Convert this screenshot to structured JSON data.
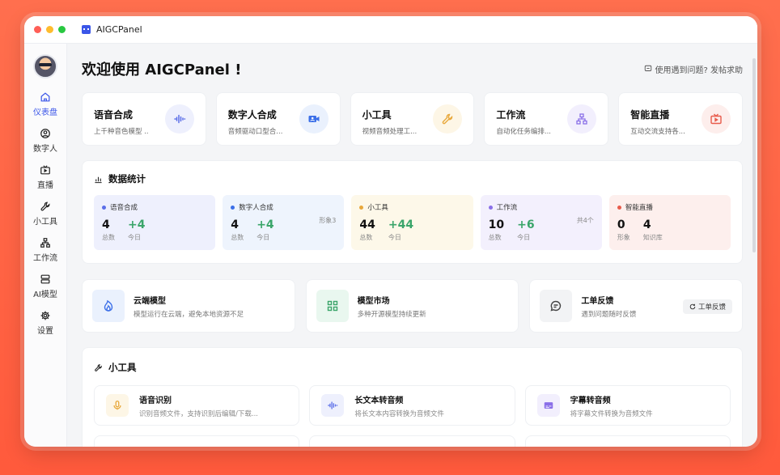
{
  "window": {
    "app_title": "AIGCPanel",
    "traffic_lights": [
      "#ff5f57",
      "#febc2e",
      "#28c840"
    ]
  },
  "sidebar": {
    "items": [
      {
        "label": "仪表盘",
        "icon": "home-icon",
        "active": true
      },
      {
        "label": "数字人",
        "icon": "user-circle-icon",
        "active": false
      },
      {
        "label": "直播",
        "icon": "tv-icon",
        "active": false
      },
      {
        "label": "小工具",
        "icon": "wrench-icon",
        "active": false
      },
      {
        "label": "工作流",
        "icon": "workflow-icon",
        "active": false
      },
      {
        "label": "AI模型",
        "icon": "server-icon",
        "active": false
      },
      {
        "label": "设置",
        "icon": "gear-icon",
        "active": false
      }
    ]
  },
  "header": {
    "title": "欢迎使用 AIGCPanel !",
    "help_text": "使用遇到问题? 发帖求助"
  },
  "features": [
    {
      "title": "语音合成",
      "desc": "上千种音色模型 ..",
      "icon": "waveform-icon",
      "color": "#5b6ee8",
      "bg": "#eef0fd"
    },
    {
      "title": "数字人合成",
      "desc": "音频驱动口型合...",
      "icon": "video-user-icon",
      "color": "#3b6fe8",
      "bg": "#eaf1fd"
    },
    {
      "title": "小工具",
      "desc": "视频音频处理工...",
      "icon": "wrench-icon",
      "color": "#e8a83b",
      "bg": "#fdf6e6"
    },
    {
      "title": "工作流",
      "desc": "自动化任务编排...",
      "icon": "workflow-icon",
      "color": "#8a6fe8",
      "bg": "#f2effd"
    },
    {
      "title": "智能直播",
      "desc": "互动交流支持各...",
      "icon": "tv-icon",
      "color": "#e85b4b",
      "bg": "#fdeeec"
    }
  ],
  "stats": {
    "title": "数据统计",
    "cards": [
      {
        "name": "语音合成",
        "dot": "#5b6ee8",
        "bg": "#eef0fd",
        "extra": "",
        "values": [
          {
            "num": "4",
            "label": "总数",
            "green": false
          },
          {
            "num": "+4",
            "label": "今日",
            "green": true
          }
        ]
      },
      {
        "name": "数字人合成",
        "dot": "#3b6fe8",
        "bg": "#eef4fd",
        "extra": "形象3",
        "values": [
          {
            "num": "4",
            "label": "总数",
            "green": false
          },
          {
            "num": "+4",
            "label": "今日",
            "green": true
          }
        ]
      },
      {
        "name": "小工具",
        "dot": "#e8a83b",
        "bg": "#fdf8e9",
        "extra": "",
        "values": [
          {
            "num": "44",
            "label": "总数",
            "green": false
          },
          {
            "num": "+44",
            "label": "今日",
            "green": true
          }
        ]
      },
      {
        "name": "工作流",
        "dot": "#8a6fe8",
        "bg": "#f3f0fd",
        "extra": "共4个",
        "values": [
          {
            "num": "10",
            "label": "总数",
            "green": false
          },
          {
            "num": "+6",
            "label": "今日",
            "green": true
          }
        ]
      },
      {
        "name": "智能直播",
        "dot": "#e85b4b",
        "bg": "#fdefed",
        "extra": "",
        "values": [
          {
            "num": "0",
            "label": "形象",
            "green": false
          },
          {
            "num": "4",
            "label": "知识库",
            "green": false
          }
        ]
      }
    ]
  },
  "info": [
    {
      "title": "云端模型",
      "desc": "模型运行在云端，避免本地资源不足",
      "icon": "flame-icon",
      "color": "#3b6fe8",
      "bg": "#eaf1fd"
    },
    {
      "title": "模型市场",
      "desc": "多种开源模型持续更新",
      "icon": "grid-icon",
      "color": "#3aa56a",
      "bg": "#e9f7ef"
    },
    {
      "title": "工单反馈",
      "desc": "遇到问题随时反馈",
      "icon": "chat-icon",
      "color": "#444444",
      "bg": "#f2f3f5",
      "button": "工单反馈"
    }
  ],
  "tools": {
    "title": "小工具",
    "items": [
      {
        "title": "语音识别",
        "desc": "识别音频文件，支持识别后编辑/下载...",
        "icon": "mic-icon",
        "color": "#e8a83b",
        "bg": "#fdf6e6"
      },
      {
        "title": "长文本转音频",
        "desc": "将长文本内容转换为音频文件",
        "icon": "waveform-icon",
        "color": "#5b6ee8",
        "bg": "#eef0fd"
      },
      {
        "title": "字幕转音频",
        "desc": "将字幕文件转换为音频文件",
        "icon": "subtitle-icon",
        "color": "#8a6fe8",
        "bg": "#f2effd"
      }
    ]
  }
}
